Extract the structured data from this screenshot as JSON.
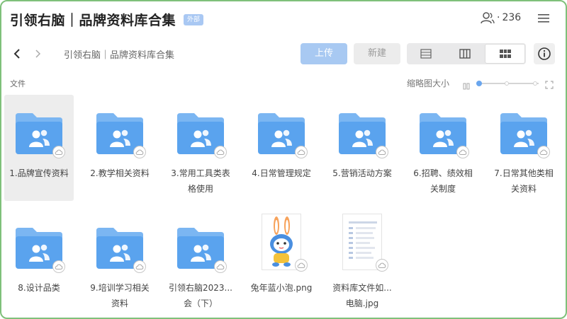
{
  "window": {
    "title": "引领右脑｜品牌资料库合集",
    "badge": "外部",
    "member_count": "236",
    "member_sep": "·"
  },
  "toolbar": {
    "breadcrumb": "引领右脑｜品牌资料库合集",
    "upload_label": "上传",
    "new_label": "新建"
  },
  "header": {
    "column_label": "文件",
    "thumb_size_label": "缩略图大小",
    "thumb_size_level": 0.0
  },
  "files": [
    {
      "name": "1.品牌宣传资料",
      "type": "shared-folder"
    },
    {
      "name": "2.教学相关资料",
      "type": "shared-folder"
    },
    {
      "name": "3.常用工具类表格使用",
      "type": "shared-folder"
    },
    {
      "name": "4.日常管理规定",
      "type": "shared-folder"
    },
    {
      "name": "5.营销活动方案",
      "type": "shared-folder"
    },
    {
      "name": "6.招聘、绩效相关制度",
      "type": "shared-folder"
    },
    {
      "name": "7.日常其他类相关资料",
      "type": "shared-folder"
    },
    {
      "name": "8.设计品类",
      "type": "shared-folder"
    },
    {
      "name": "9.培训学习相关资料",
      "type": "shared-folder"
    },
    {
      "name": "引领右脑2023...会（下）",
      "type": "shared-folder"
    },
    {
      "name": "兔年蓝小泡.png",
      "type": "image-rabbit"
    },
    {
      "name": "资料库文件如...电脑.jpg",
      "type": "image-doc"
    }
  ],
  "colors": {
    "folder": "#5aa3ee",
    "folder_back": "#7bb6f2",
    "accent": "#6aa6ee",
    "frame": "#7fc07a"
  }
}
